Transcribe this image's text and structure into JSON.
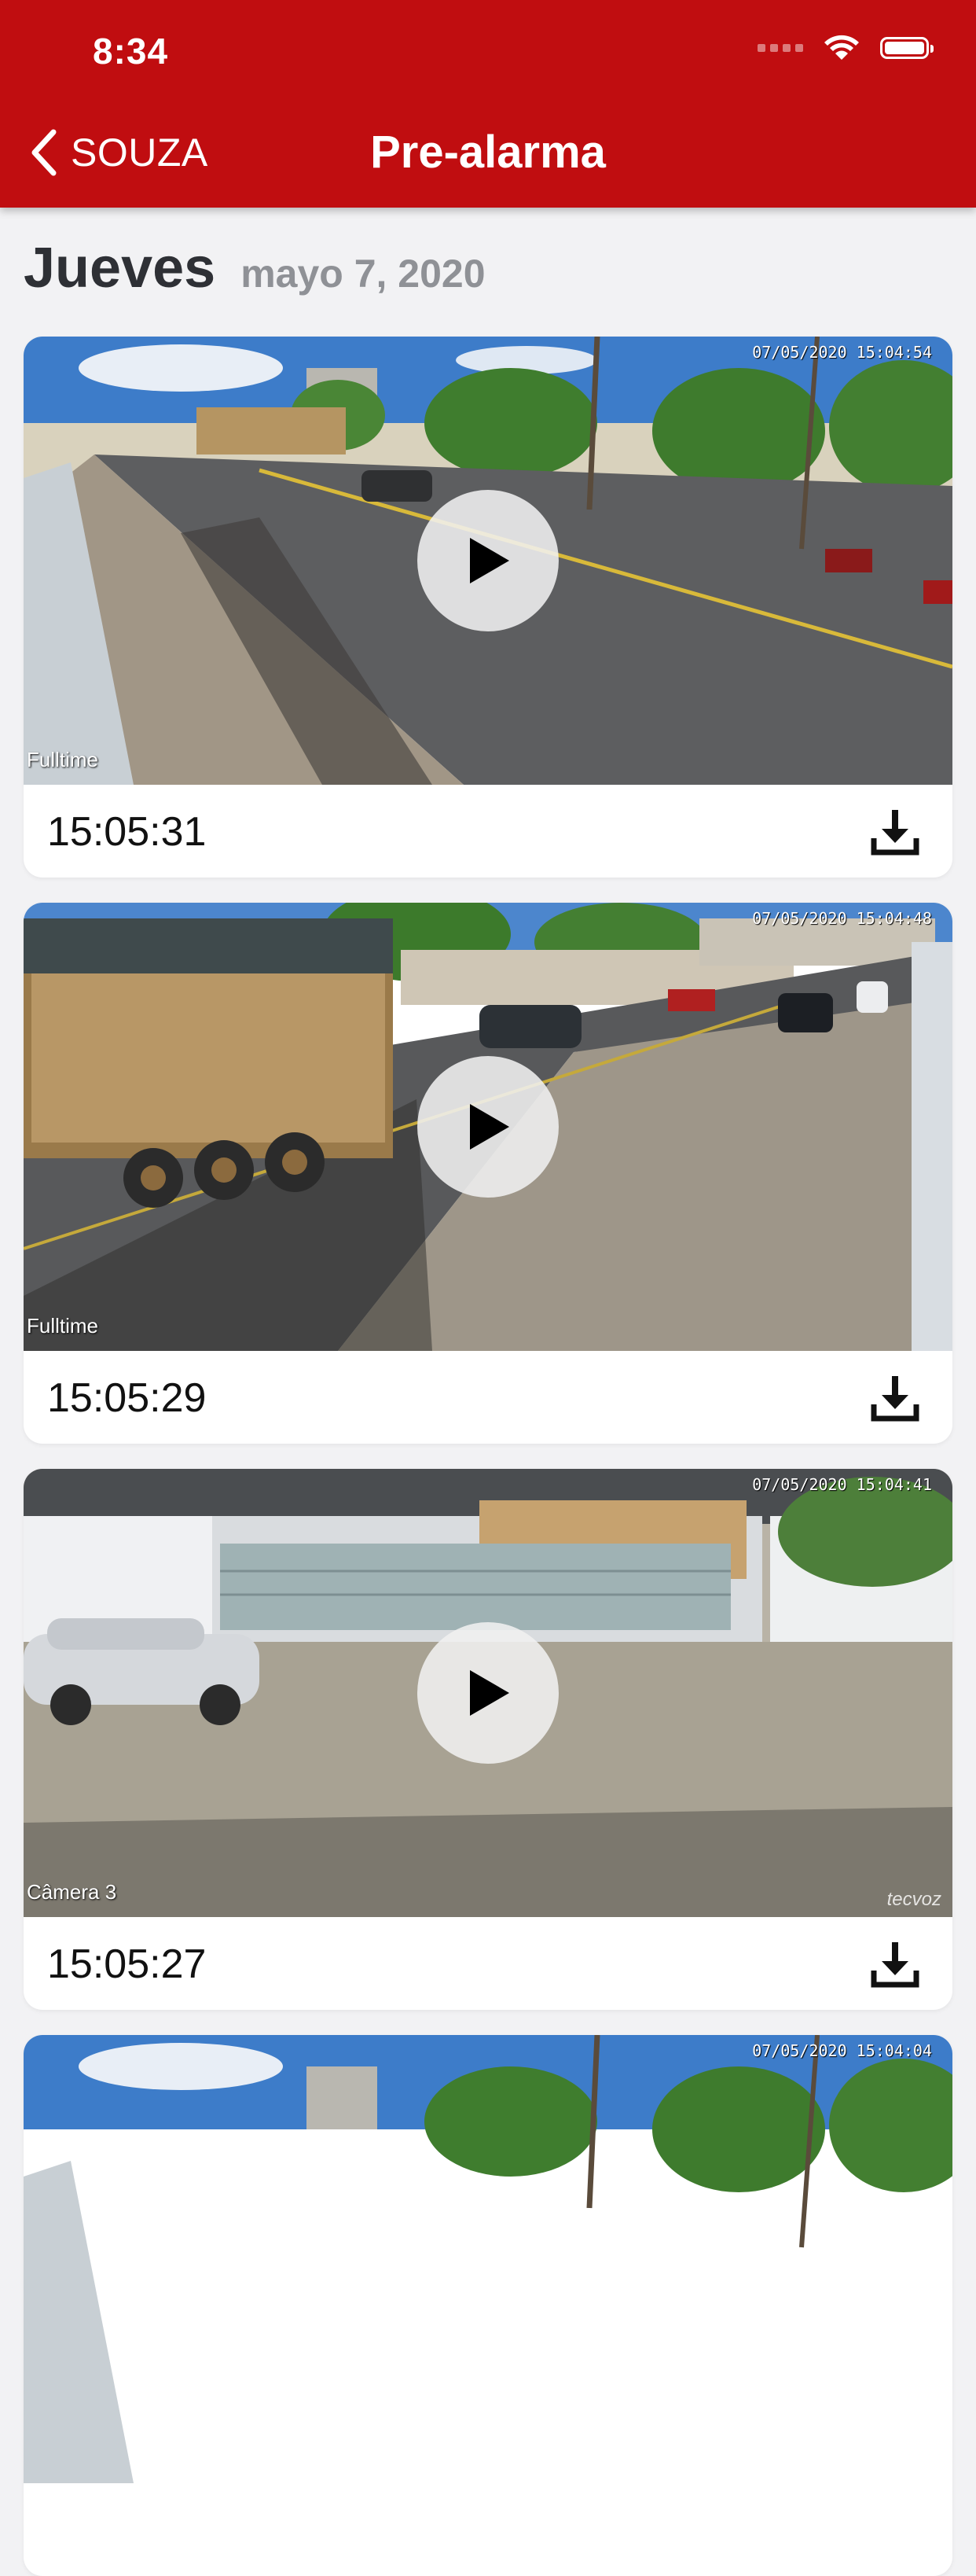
{
  "status": {
    "time": "8:34"
  },
  "nav": {
    "back_label": "SOUZA",
    "title": "Pre-alarma"
  },
  "section": {
    "day": "Jueves",
    "date": "mayo 7, 2020"
  },
  "clips": [
    {
      "time": "15:05:31",
      "camera_label": "Fulltime",
      "overlay_timestamp": "07/05/2020 15:04:54",
      "watermark": ""
    },
    {
      "time": "15:05:29",
      "camera_label": "Fulltime",
      "overlay_timestamp": "07/05/2020 15:04:48",
      "watermark": ""
    },
    {
      "time": "15:05:27",
      "camera_label": "Câmera 3",
      "overlay_timestamp": "07/05/2020 15:04:41",
      "watermark": "tecvoz"
    },
    {
      "time": "",
      "camera_label": "",
      "overlay_timestamp": "07/05/2020 15:04:04",
      "watermark": ""
    }
  ],
  "colors": {
    "header": "#c00d10",
    "background": "#f2f2f4"
  },
  "icons": {
    "back": "chevron-left-icon",
    "play": "play-icon",
    "download": "download-icon"
  }
}
